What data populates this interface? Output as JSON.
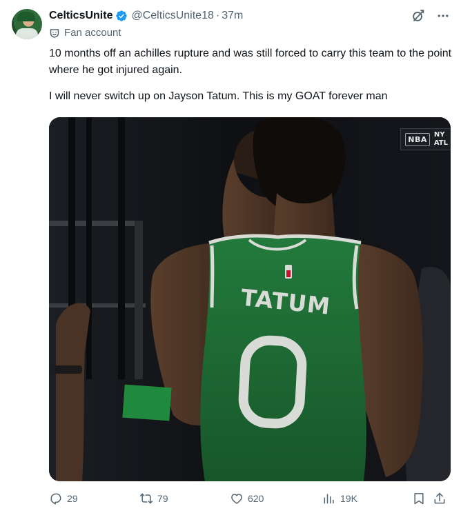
{
  "author": {
    "display_name": "CelticsUnite",
    "handle": "@CelticsUnite18",
    "separator": "·",
    "time": "37m",
    "verified_icon": "verified-badge-icon",
    "label_icon": "fan-account-icon",
    "label": "Fan account"
  },
  "header_actions": {
    "grok_icon": "grok-icon",
    "more_icon": "more-icon"
  },
  "tweet": {
    "paragraph_1": "10 months off an achilles rupture and was still forced to carry this team to the point where he got injured again.",
    "paragraph_2": "I will never switch up on Jayson Tatum. This is my GOAT forever man"
  },
  "media": {
    "jersey_name": "TATUM",
    "jersey_number": "0",
    "broadcast": {
      "logo": "NBA",
      "team_1": "NY",
      "team_2": "ATL"
    },
    "colors": {
      "jersey_green": "#1f6b36",
      "background": "#101318"
    }
  },
  "actions": {
    "replies": "29",
    "reposts": "79",
    "likes": "620",
    "views": "19K",
    "icons": [
      "reply-icon",
      "repost-icon",
      "like-icon",
      "views-icon",
      "bookmark-icon",
      "share-icon"
    ]
  },
  "colors": {
    "text_primary": "#0f1419",
    "text_secondary": "#536471",
    "verified_blue": "#1d9bf0"
  }
}
